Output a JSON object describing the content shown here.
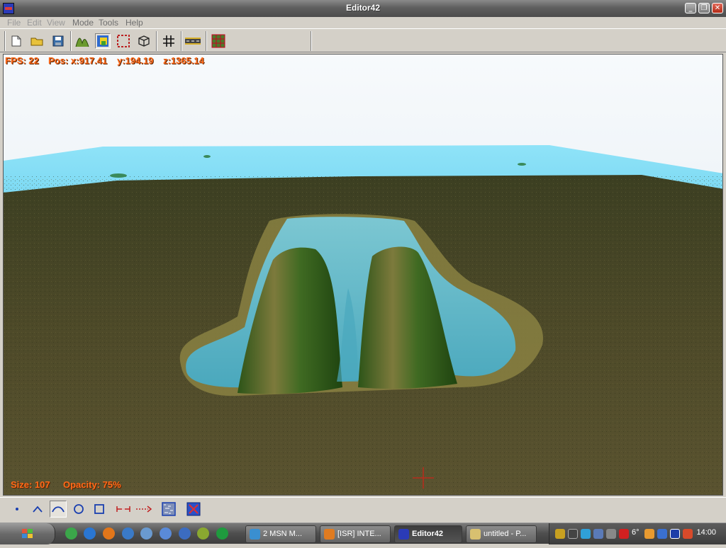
{
  "window": {
    "title": "Editor42",
    "minimize_glyph": "_",
    "restore_glyph": "❐",
    "close_glyph": "✕"
  },
  "menu": {
    "items": [
      "File",
      "Edit",
      "View",
      "Mode",
      "Tools",
      "Help"
    ]
  },
  "toolbar": {
    "buttons": [
      {
        "name": "new-file-icon"
      },
      {
        "name": "open-folder-icon"
      },
      {
        "name": "save-disk-icon"
      },
      {
        "name": "terrain-height-icon"
      },
      {
        "name": "terrain-paint-icon",
        "pressed": true
      },
      {
        "name": "selection-border-icon"
      },
      {
        "name": "object-cube-icon"
      },
      {
        "name": "grid-icon"
      },
      {
        "name": "road-icon"
      },
      {
        "name": "tile-grid-icon"
      }
    ]
  },
  "hud": {
    "fps_label": "FPS: 22",
    "pos_label": "Pos: x:917.41",
    "pos_y": "y:194.19",
    "pos_z": "z:1365.14",
    "size_label": "Size: 107",
    "opacity_label": "Opacity: 75%"
  },
  "brush_toolbar": {
    "buttons": [
      {
        "name": "brush-point-icon"
      },
      {
        "name": "brush-peak-icon"
      },
      {
        "name": "brush-smooth-icon",
        "pressed": true
      },
      {
        "name": "brush-circle-icon"
      },
      {
        "name": "brush-square-icon"
      },
      {
        "name": "measure-distance-icon"
      },
      {
        "name": "dotted-arrow-icon"
      },
      {
        "name": "noise-texture-icon"
      },
      {
        "name": "fit-view-icon"
      }
    ]
  },
  "taskbar": {
    "tasks": [
      {
        "label": "2 MSN M...",
        "color": "#3a8fd0"
      },
      {
        "label": "[ISR] INTE...",
        "color": "#e07b20"
      },
      {
        "label": "Editor42",
        "color": "#2b3bb8",
        "active": true
      },
      {
        "label": "untitled - P...",
        "color": "#d8c070"
      }
    ],
    "tray_temp": "6°",
    "clock": "14:00"
  },
  "colors": {
    "hud_text": "#ff6a1a",
    "water": "#7fdcf5",
    "ground": "#4a4a26"
  }
}
